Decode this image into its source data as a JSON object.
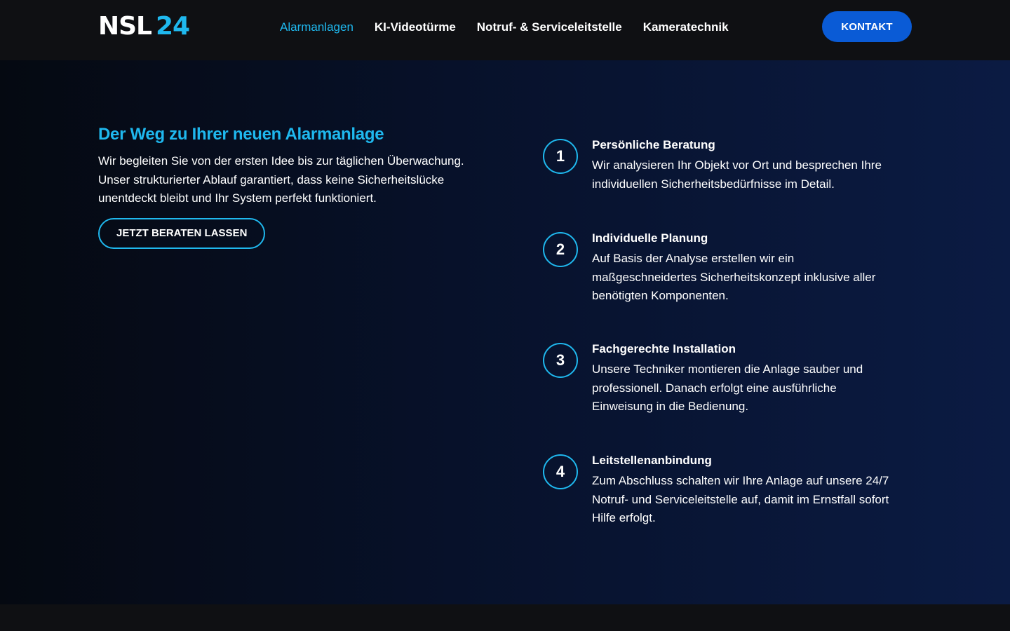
{
  "header": {
    "logo": {
      "part1": "NSL",
      "part2": "24"
    },
    "nav": [
      {
        "label": "Alarmanlagen",
        "active": true
      },
      {
        "label": "KI-Videotürme",
        "active": false
      },
      {
        "label": "Notruf- & Serviceleitstelle",
        "active": false
      },
      {
        "label": "Kameratechnik",
        "active": false
      }
    ],
    "contact_label": "KONTAKT"
  },
  "hero": {
    "title": "Der Weg zu Ihrer neuen Alarmanlage",
    "text": "Wir begleiten Sie von der ersten Idee bis zur täglichen Überwachung. Unser strukturierter Ablauf garantiert, dass keine Sicherheitslücke unentdeckt bleibt und Ihr System perfekt funktioniert.",
    "cta_label": "JETZT BERATEN LASSEN"
  },
  "steps": [
    {
      "number": "1",
      "title": "Persönliche Beratung",
      "description": "Wir analysieren Ihr Objekt vor Ort und besprechen Ihre individuellen Sicherheitsbedürfnisse im Detail."
    },
    {
      "number": "2",
      "title": "Individuelle Planung",
      "description": "Auf Basis der Analyse erstellen wir ein maßgeschneidertes Sicherheitskonzept inklusive aller benötigten Komponenten."
    },
    {
      "number": "3",
      "title": "Fachgerechte Installation",
      "description": "Unsere Techniker montieren die Anlage sauber und professionell. Danach erfolgt eine ausführliche Einweisung in die Bedienung."
    },
    {
      "number": "4",
      "title": "Leitstellenanbindung",
      "description": "Zum Abschluss schalten wir Ihre Anlage auf unsere 24/7 Notruf- und Serviceleitstelle auf, damit im Ernstfall sofort Hilfe erfolgt."
    }
  ],
  "colors": {
    "accent": "#1fb8ee",
    "button_blue": "#0a5bd6",
    "header_bg": "#0f1013",
    "hero_gradient_start": "#050911",
    "hero_gradient_end": "#0b1b43"
  }
}
